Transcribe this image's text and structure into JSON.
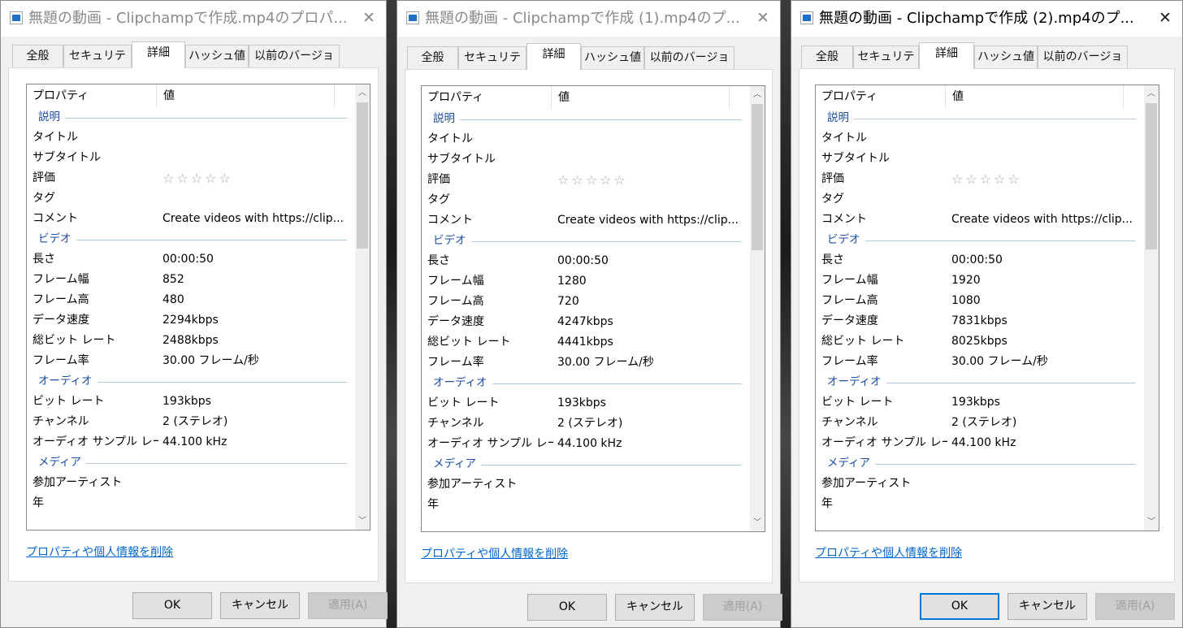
{
  "tabs": [
    "全般",
    "セキュリティ",
    "詳細",
    "ハッシュ値",
    "以前のバージョン"
  ],
  "header": {
    "property": "プロパティ",
    "value": "値"
  },
  "groups": {
    "description": "説明",
    "video": "ビデオ",
    "audio": "オーディオ",
    "media": "メディア"
  },
  "labels": {
    "title": "タイトル",
    "subtitle": "サブタイトル",
    "rating": "評価",
    "tags": "タグ",
    "comment": "コメント",
    "length": "長さ",
    "frame_width": "フレーム幅",
    "frame_height": "フレーム高",
    "data_rate": "データ速度",
    "total_bitrate": "総ビット レート",
    "frame_rate": "フレーム率",
    "bitrate": "ビット レート",
    "channels": "チャンネル",
    "sample_rate": "オーディオ サンプル レート",
    "contributing_artists": "参加アーティスト",
    "year": "年"
  },
  "rating_stars": "☆☆☆☆☆",
  "remove_link": "プロパティや個人情報を削除",
  "buttons": {
    "ok": "OK",
    "cancel": "キャンセル",
    "apply": "適用(A)"
  },
  "close_glyph": "✕",
  "dialogs": [
    {
      "title": "無題の動画 - Clipchampで作成.mp4のプロパ...",
      "comment": "Create videos with https://clip...",
      "length": "00:00:50",
      "frame_width": "852",
      "frame_height": "480",
      "data_rate": "2294kbps",
      "total_bitrate": "2488kbps",
      "frame_rate": "30.00 フレーム/秒",
      "audio_bitrate": "193kbps",
      "channels": "2 (ステレオ)",
      "sample_rate": "44.100 kHz"
    },
    {
      "title": "無題の動画 - Clipchampで作成 (1).mp4のプ...",
      "comment": "Create videos with https://clip...",
      "length": "00:00:50",
      "frame_width": "1280",
      "frame_height": "720",
      "data_rate": "4247kbps",
      "total_bitrate": "4441kbps",
      "frame_rate": "30.00 フレーム/秒",
      "audio_bitrate": "193kbps",
      "channels": "2 (ステレオ)",
      "sample_rate": "44.100 kHz"
    },
    {
      "title": "無題の動画 - Clipchampで作成 (2).mp4のプ...",
      "comment": "Create videos with https://clip...",
      "length": "00:00:50",
      "frame_width": "1920",
      "frame_height": "1080",
      "data_rate": "7831kbps",
      "total_bitrate": "8025kbps",
      "frame_rate": "30.00 フレーム/秒",
      "audio_bitrate": "193kbps",
      "channels": "2 (ステレオ)",
      "sample_rate": "44.100 kHz"
    }
  ]
}
